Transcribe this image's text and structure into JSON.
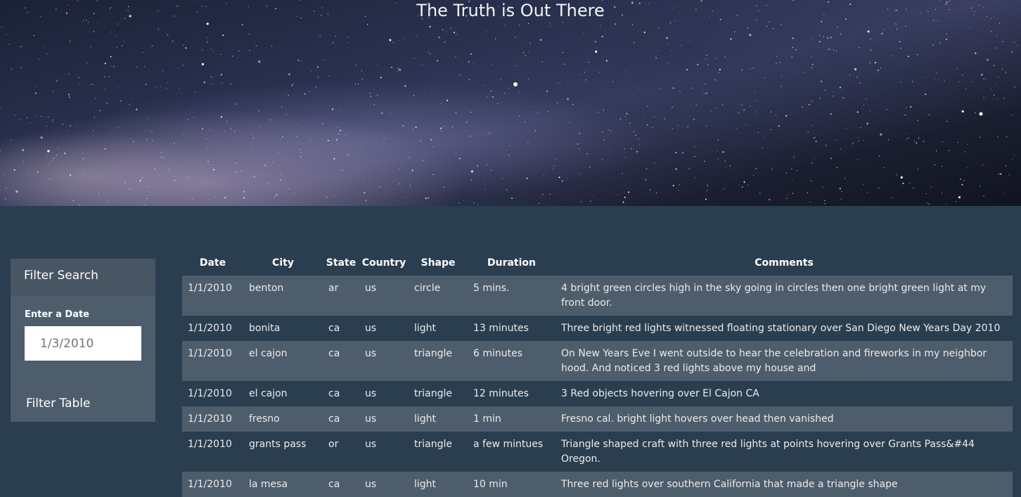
{
  "header": {
    "title": "The Truth is Out There"
  },
  "filter": {
    "heading": "Filter Search",
    "date_label": "Enter a Date",
    "date_placeholder": "1/3/2010",
    "button_label": "Filter Table"
  },
  "table": {
    "columns": [
      "Date",
      "City",
      "State",
      "Country",
      "Shape",
      "Duration",
      "Comments"
    ],
    "rows": [
      [
        "1/1/2010",
        "benton",
        "ar",
        "us",
        "circle",
        "5 mins.",
        "4 bright green circles high in the sky going in circles then one bright green light at my front door."
      ],
      [
        "1/1/2010",
        "bonita",
        "ca",
        "us",
        "light",
        "13 minutes",
        "Three bright red lights witnessed floating stationary over San Diego New Years Day 2010"
      ],
      [
        "1/1/2010",
        "el cajon",
        "ca",
        "us",
        "triangle",
        "6 minutes",
        "On New Years Eve I went outside to hear the celebration and fireworks in my neighbor hood. And noticed 3 red lights above my house and"
      ],
      [
        "1/1/2010",
        "el cajon",
        "ca",
        "us",
        "triangle",
        "12 minutes",
        "3 Red objects hovering over El Cajon CA"
      ],
      [
        "1/1/2010",
        "fresno",
        "ca",
        "us",
        "light",
        "1 min",
        "Fresno cal. bright light hovers over head then vanished"
      ],
      [
        "1/1/2010",
        "grants pass",
        "or",
        "us",
        "triangle",
        "a few mintues",
        "Triangle shaped craft with three red lights at points hovering over Grants Pass&#44 Oregon."
      ],
      [
        "1/1/2010",
        "la mesa",
        "ca",
        "us",
        "light",
        "10 min",
        "Three red lights over southern California that made a triangle shape"
      ]
    ]
  },
  "colors": {
    "page_bg": "#2b3e50",
    "row_alt_bg": "#4e5d6c",
    "panel_bg": "#4e5d6c",
    "text": "#ebebeb"
  }
}
